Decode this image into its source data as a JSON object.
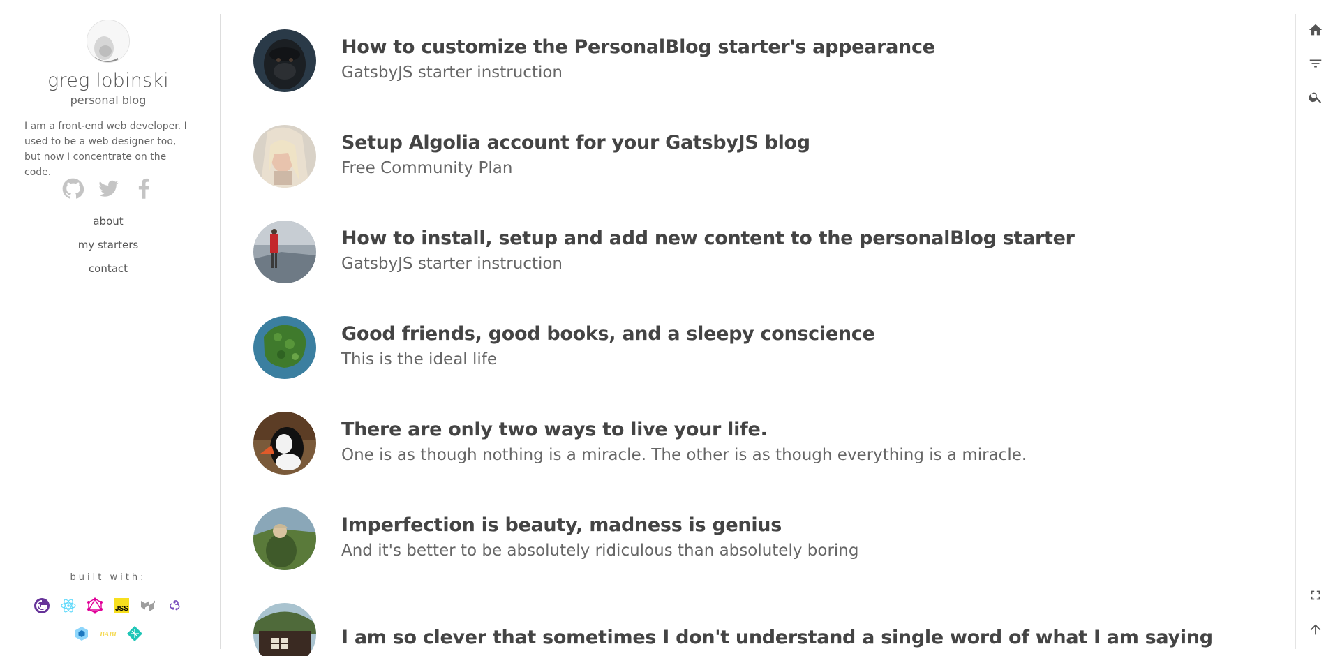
{
  "sidebar": {
    "author_name": "greg lobinski",
    "author_subtitle": "personal blog",
    "author_bio": "I am a front-end web developer. I used to be a web designer too, but now I concentrate on the code.",
    "social": [
      "github-icon",
      "twitter-icon",
      "facebook-icon"
    ],
    "nav": [
      "about",
      "my starters",
      "contact"
    ],
    "built_with_label": "built with:",
    "stack_icons": [
      "gatsby-icon",
      "react-icon",
      "graphql-icon",
      "jss-icon",
      "material-ui-icon",
      "redux-icon",
      "webpack-icon",
      "babel-icon",
      "netlify-icon"
    ]
  },
  "posts": [
    {
      "title": "How to customize the PersonalBlog starter's appearance",
      "subtitle": "GatsbyJS starter instruction"
    },
    {
      "title": "Setup Algolia account for your GatsbyJS blog",
      "subtitle": "Free Community Plan"
    },
    {
      "title": "How to install, setup and add new content to the personalBlog starter",
      "subtitle": "GatsbyJS starter instruction"
    },
    {
      "title": "Good friends, good books, and a sleepy conscience",
      "subtitle": "This is the ideal life"
    },
    {
      "title": "There are only two ways to live your life.",
      "subtitle": "One is as though nothing is a miracle. The other is as though everything is a miracle."
    },
    {
      "title": "Imperfection is beauty, madness is genius",
      "subtitle": "And it's better to be absolutely ridiculous than absolutely boring"
    },
    {
      "title": "I am so clever that sometimes I don't understand a single word of what I am saying",
      "subtitle": ""
    }
  ],
  "rail": [
    "home-icon",
    "filter-icon",
    "search-icon",
    "fullscreen-icon",
    "arrow-up-icon"
  ],
  "colors": {
    "text": "#555555",
    "title": "#444444",
    "rule": "#dddddd",
    "icon": "#555555"
  }
}
